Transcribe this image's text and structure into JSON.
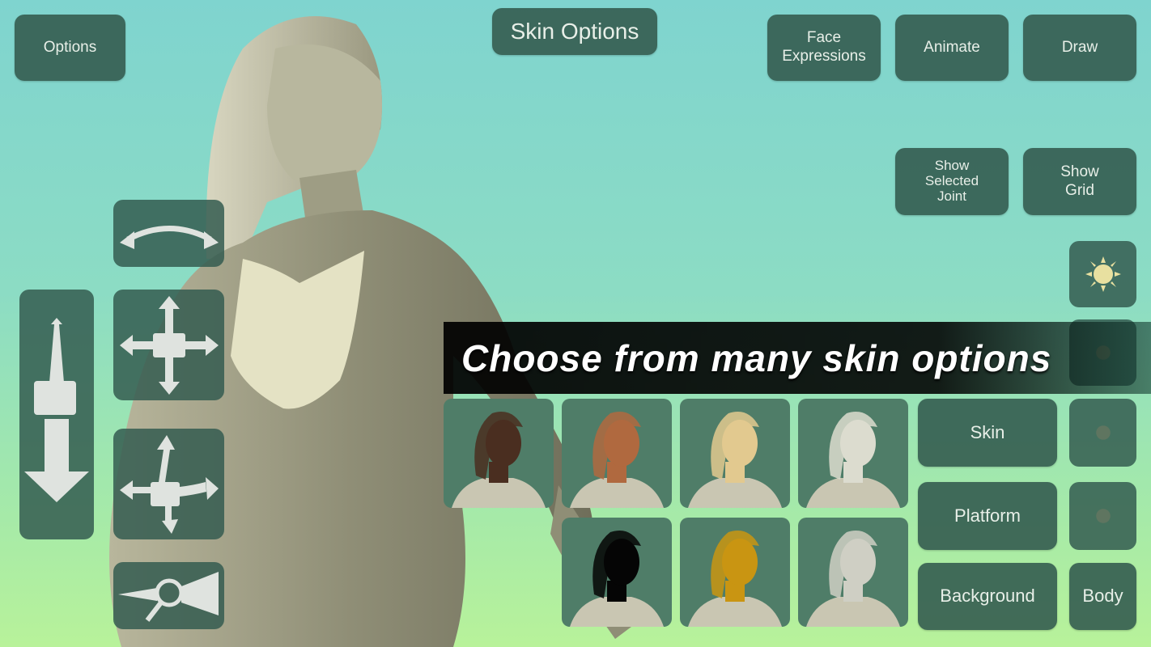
{
  "header": {
    "options_label": "Options",
    "title": "Skin Options",
    "face_expressions_label": "Face Expressions",
    "animate_label": "Animate",
    "draw_label": "Draw"
  },
  "toggles": {
    "show_selected_joint_label": "Show Selected Joint",
    "show_grid_label": "Show Grid"
  },
  "banner": {
    "text": "Choose from many skin options"
  },
  "skin_panel": {
    "skin_label": "Skin",
    "platform_label": "Platform",
    "background_label": "Background",
    "body_label": "Body",
    "swatches": [
      {
        "name": "dark",
        "color": "#4a2e20"
      },
      {
        "name": "tan",
        "color": "#b0693f"
      },
      {
        "name": "light",
        "color": "#e2c98f"
      },
      {
        "name": "pale",
        "color": "#dcdccf"
      },
      {
        "name": "black",
        "color": "#050505"
      },
      {
        "name": "gold",
        "color": "#c99512"
      },
      {
        "name": "silver",
        "color": "#cfcfc4"
      }
    ]
  },
  "camera_controls": [
    "rotate-icon",
    "dolly-icon",
    "pan-icon",
    "orbit-icon",
    "zoom-icon"
  ],
  "colors": {
    "button": "#345c50",
    "model": "#8b8a72",
    "sun": "#e8e0a0"
  }
}
